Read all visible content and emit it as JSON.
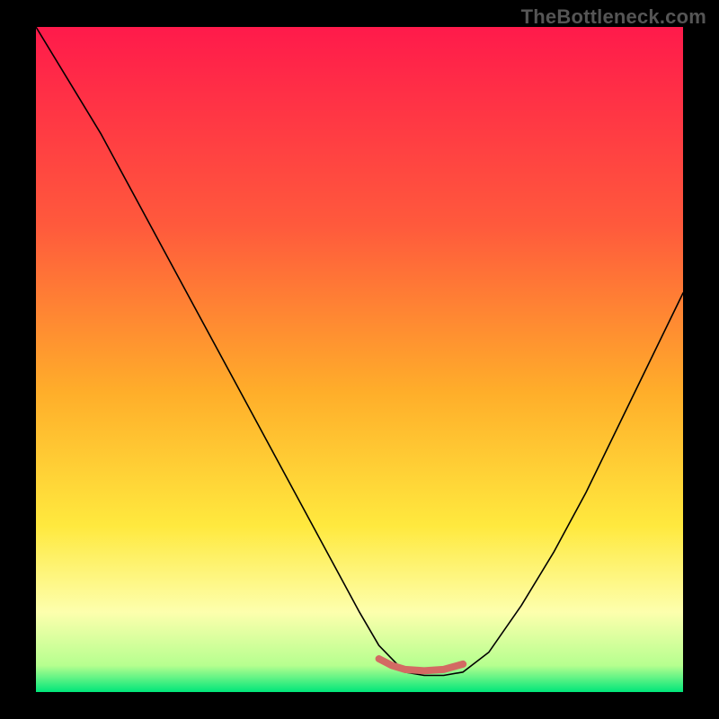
{
  "watermark": "TheBottleneck.com",
  "chart_data": {
    "type": "line",
    "title": "",
    "xlabel": "",
    "ylabel": "",
    "xlim": [
      0,
      100
    ],
    "ylim": [
      0,
      100
    ],
    "background_gradient": {
      "stops": [
        {
          "offset": 0.0,
          "color": "#ff1a4b"
        },
        {
          "offset": 0.3,
          "color": "#ff5a3c"
        },
        {
          "offset": 0.55,
          "color": "#ffae2a"
        },
        {
          "offset": 0.75,
          "color": "#ffe93e"
        },
        {
          "offset": 0.88,
          "color": "#fdffad"
        },
        {
          "offset": 0.96,
          "color": "#b6ff8f"
        },
        {
          "offset": 1.0,
          "color": "#00e67a"
        }
      ]
    },
    "series": [
      {
        "name": "bottleneck-curve",
        "x": [
          0,
          5,
          10,
          15,
          20,
          25,
          30,
          35,
          40,
          45,
          50,
          53,
          57,
          60,
          63,
          66,
          70,
          75,
          80,
          85,
          90,
          95,
          100
        ],
        "y": [
          100,
          92,
          84,
          75,
          66,
          57,
          48,
          39,
          30,
          21,
          12,
          7,
          3,
          2.5,
          2.5,
          3,
          6,
          13,
          21,
          30,
          40,
          50,
          60
        ],
        "color": "#000000",
        "width": 1.6
      },
      {
        "name": "optimal-zone",
        "x": [
          53,
          55,
          57,
          60,
          63,
          66
        ],
        "y": [
          5.0,
          4.0,
          3.4,
          3.2,
          3.4,
          4.2
        ],
        "color": "#d36a63",
        "width": 8
      }
    ]
  }
}
